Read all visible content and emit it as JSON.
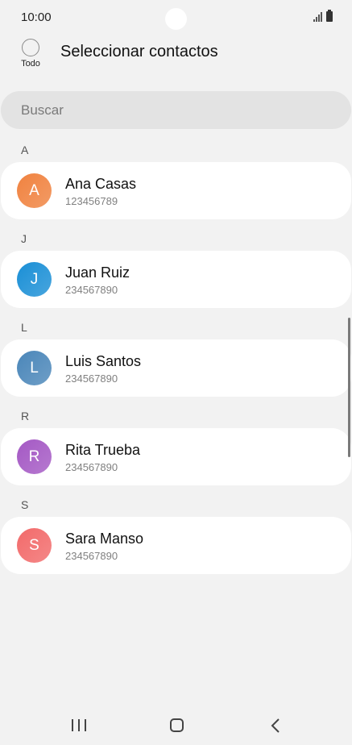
{
  "status_bar": {
    "time": "10:00"
  },
  "header": {
    "select_all_label": "Todo",
    "title": "Seleccionar contactos"
  },
  "search": {
    "placeholder": "Buscar"
  },
  "sections": [
    {
      "letter": "A",
      "contact": {
        "initial": "A",
        "name": "Ana Casas",
        "number": "123456789",
        "avatar_color": "#f0823f"
      }
    },
    {
      "letter": "J",
      "contact": {
        "initial": "J",
        "name": "Juan Ruiz",
        "number": "234567890",
        "avatar_color": "#1a8fd6"
      }
    },
    {
      "letter": "L",
      "contact": {
        "initial": "L",
        "name": "Luis Santos",
        "number": "234567890",
        "avatar_color": "#4a86b9"
      }
    },
    {
      "letter": "R",
      "contact": {
        "initial": "R",
        "name": "Rita Trueba",
        "number": "234567890",
        "avatar_color": "#a458c4"
      }
    },
    {
      "letter": "S",
      "contact": {
        "initial": "S",
        "name": "Sara Manso",
        "number": "234567890",
        "avatar_color": "#f26a6a"
      }
    }
  ],
  "nav_bar": {
    "recent_icon": "recent-apps-icon",
    "home_icon": "home-icon",
    "back_icon": "back-icon"
  }
}
